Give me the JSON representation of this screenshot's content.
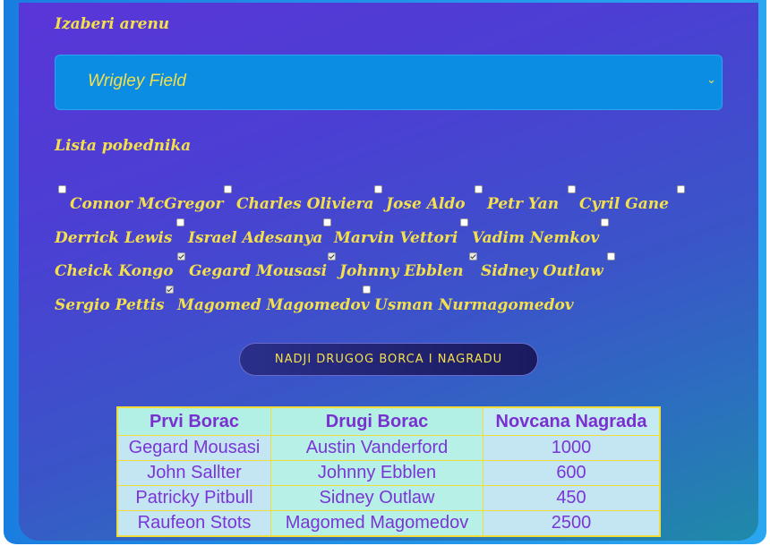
{
  "arena": {
    "label": "Izaberi arenu",
    "selected": "Wrigley Field"
  },
  "winners": {
    "label": "Lista pobednika",
    "fighters": [
      {
        "name": "Connor McGregor",
        "checked": false
      },
      {
        "name": "Charles Oliviera",
        "checked": false
      },
      {
        "name": "Jose Aldo",
        "checked": false
      },
      {
        "name": "Petr Yan",
        "checked": false
      },
      {
        "name": "Cyril Gane",
        "checked": false
      },
      {
        "name": "Derrick Lewis",
        "checked": false
      },
      {
        "name": "Israel Adesanya",
        "checked": false
      },
      {
        "name": "Marvin Vettori",
        "checked": false
      },
      {
        "name": "Vadim Nemkov",
        "checked": false
      },
      {
        "name": "Cheick Kongo",
        "checked": false
      },
      {
        "name": "Gegard Mousasi",
        "checked": true
      },
      {
        "name": "Johnny Ebblen",
        "checked": true
      },
      {
        "name": "Sidney Outlaw",
        "checked": true
      },
      {
        "name": "Sergio Pettis",
        "checked": false
      },
      {
        "name": "Magomed Magomedov",
        "checked": true
      },
      {
        "name": "Usman Nurmagomedov",
        "checked": false
      }
    ]
  },
  "action_button": "NADJI DRUGOG BORCA I NAGRADU",
  "results": {
    "headers": [
      "Prvi Borac",
      "Drugi Borac",
      "Novcana Nagrada"
    ],
    "rows": [
      [
        "Gegard Mousasi",
        "Austin Vanderford",
        "1000"
      ],
      [
        "John Sallter",
        "Johnny Ebblen",
        "600"
      ],
      [
        "Patricky Pitbull",
        "Sidney Outlaw",
        "450"
      ],
      [
        "Raufeon Stots",
        "Magomed Magomedov",
        "2500"
      ]
    ]
  },
  "colors": {
    "accent_text": "#f4e04a",
    "table_text": "#7a35d6",
    "select_bg": "#0a8de3"
  },
  "icons": {
    "dropdown": "chevron-down-icon"
  }
}
